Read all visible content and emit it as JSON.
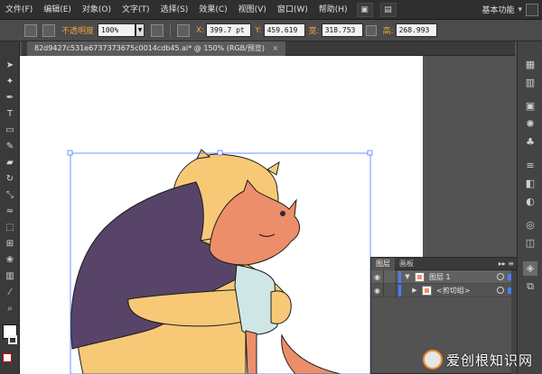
{
  "menubar": {
    "items": [
      "文件(F)",
      "编辑(E)",
      "对象(O)",
      "文字(T)",
      "选择(S)",
      "效果(C)",
      "视图(V)",
      "窗口(W)",
      "帮助(H)"
    ],
    "workspace": "基本功能"
  },
  "controlbar": {
    "opacity_label": "不透明度",
    "opacity_value": "100%",
    "x_label": "X:",
    "x_value": "399.7 pt",
    "y_label": "Y:",
    "y_value": "459.619",
    "w_label": "宽:",
    "w_value": "318.753",
    "h_label": "高:",
    "h_value": "268.993"
  },
  "document": {
    "tab_title": "82d9427c531e6737373675c0014cdb45.ai* @ 150% (RGB/预览)",
    "close_glyph": "×"
  },
  "layers_panel": {
    "tabs": [
      "图层",
      "画板"
    ],
    "menu_glyph": "▸▸ ≡",
    "layers": [
      {
        "name": "图层 1",
        "expanded": true,
        "selected": true
      },
      {
        "name": "<剪切组>",
        "expanded": false,
        "selected": false
      }
    ]
  },
  "watermark": {
    "text": "爱创根知识网"
  },
  "colors": {
    "accent": "#4a7cff",
    "label_orange": "#f0a23c",
    "shirt": "#574468",
    "skin_yellow": "#f7c977",
    "fox": "#ec8e6a"
  }
}
